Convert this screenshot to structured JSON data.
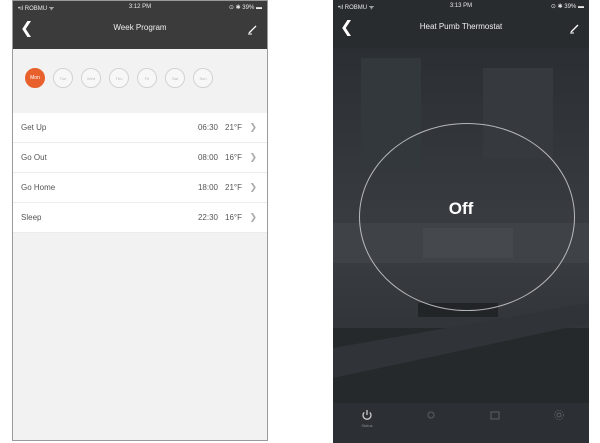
{
  "left_screen": {
    "status_bar": {
      "carrier": "•ıl ROBMU ᯤ",
      "time": "3:12 PM",
      "icons": "⊙ ✱ 39% ▬"
    },
    "title": "Week Program",
    "days": [
      "Mon",
      "Tue",
      "Wed",
      "Thu",
      "Fri",
      "Sat",
      "Sun"
    ],
    "active_day": "Mon",
    "schedule": [
      {
        "name": "Get Up",
        "time": "06:30",
        "temp": "21°F"
      },
      {
        "name": "Go Out",
        "time": "08:00",
        "temp": "16°F"
      },
      {
        "name": "Go Home",
        "time": "18:00",
        "temp": "21°F"
      },
      {
        "name": "Sleep",
        "time": "22:30",
        "temp": "16°F"
      }
    ]
  },
  "right_screen": {
    "status_bar": {
      "carrier": "•ıl ROBMU ᯤ",
      "time": "3:13 PM",
      "icons": "⊙ ✱ 39% ▬"
    },
    "title": "Heat Pumb Thermostat",
    "dial_state": "Off",
    "tabs": [
      "Status",
      "",
      "",
      ""
    ]
  },
  "colors": {
    "accent": "#e8612c",
    "navbar": "#3b3b3b",
    "dark_bg": "#2f3337"
  },
  "icons": [
    "back-icon",
    "edit-icon",
    "power-icon",
    "mode-icon",
    "program-icon",
    "settings-icon",
    "chevron-right-icon"
  ]
}
